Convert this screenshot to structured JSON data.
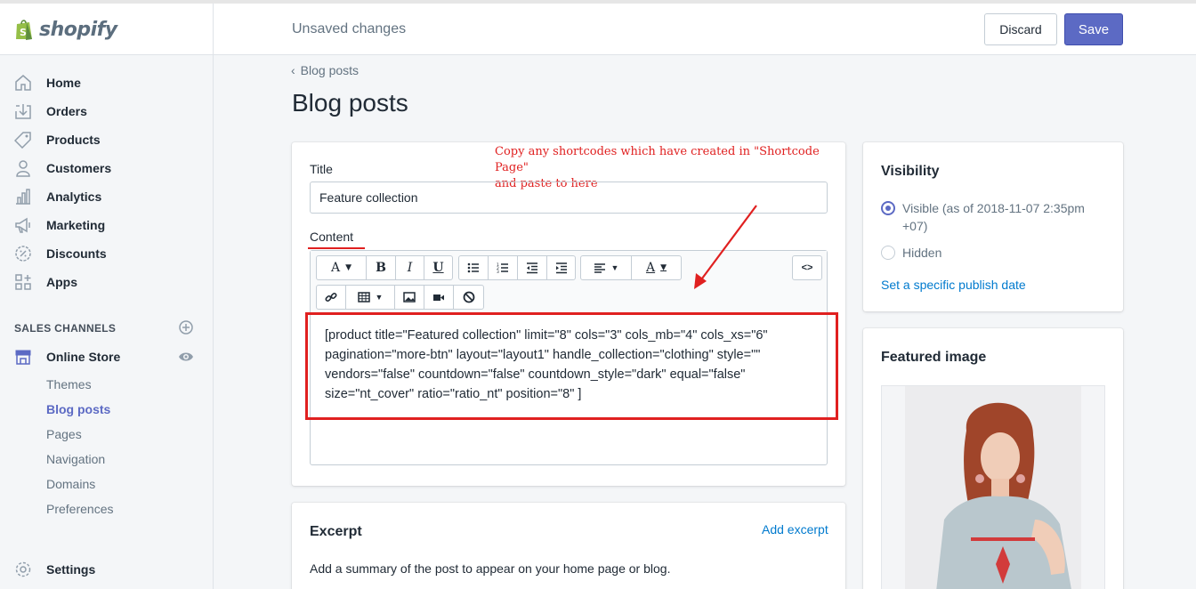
{
  "topbar": {
    "brand": "shopify",
    "status": "Unsaved changes",
    "discard_label": "Discard",
    "save_label": "Save"
  },
  "sidebar": {
    "items": [
      {
        "label": "Home",
        "icon": "home-icon"
      },
      {
        "label": "Orders",
        "icon": "orders-icon"
      },
      {
        "label": "Products",
        "icon": "tag-icon"
      },
      {
        "label": "Customers",
        "icon": "person-icon"
      },
      {
        "label": "Analytics",
        "icon": "bar-chart-icon"
      },
      {
        "label": "Marketing",
        "icon": "megaphone-icon"
      },
      {
        "label": "Discounts",
        "icon": "discount-icon"
      },
      {
        "label": "Apps",
        "icon": "apps-icon"
      }
    ],
    "channels_heading": "SALES CHANNELS",
    "online_store": "Online Store",
    "sub_items": [
      "Themes",
      "Blog posts",
      "Pages",
      "Navigation",
      "Domains",
      "Preferences"
    ],
    "settings": "Settings"
  },
  "main": {
    "breadcrumb": "Blog posts",
    "title": "Blog posts",
    "title_label": "Title",
    "title_value": "Feature collection",
    "content_label": "Content",
    "annotation_line1": "Copy any shortcodes which have created in \"Shortcode Page\"",
    "annotation_line2": "and paste to here",
    "shortcode": "[product title=\"Featured collection\" limit=\"8\" cols=\"3\" cols_mb=\"4\" cols_xs=\"6\" pagination=\"more-btn\" layout=\"layout1\" handle_collection=\"clothing\" style=\"\" vendors=\"false\" countdown=\"false\" countdown_style=\"dark\" equal=\"false\" size=\"nt_cover\" ratio=\"ratio_nt\" position=\"8\" ]",
    "toolbar": {
      "font_glyph": "A",
      "bold": "B",
      "italic": "I",
      "underline": "U",
      "color_glyph": "A",
      "html_toggle": "<>"
    },
    "excerpt_title": "Excerpt",
    "add_excerpt": "Add excerpt",
    "excerpt_help": "Add a summary of the post to appear on your home page or blog."
  },
  "visibility": {
    "title": "Visibility",
    "visible_label": "Visible (as of 2018-11-07 2:35pm +07)",
    "hidden_label": "Hidden",
    "publish_link": "Set a specific publish date"
  },
  "featured": {
    "title": "Featured image"
  },
  "colors": {
    "accent": "#5c6ac4",
    "annotation_red": "#e02020",
    "link": "#007ace"
  }
}
